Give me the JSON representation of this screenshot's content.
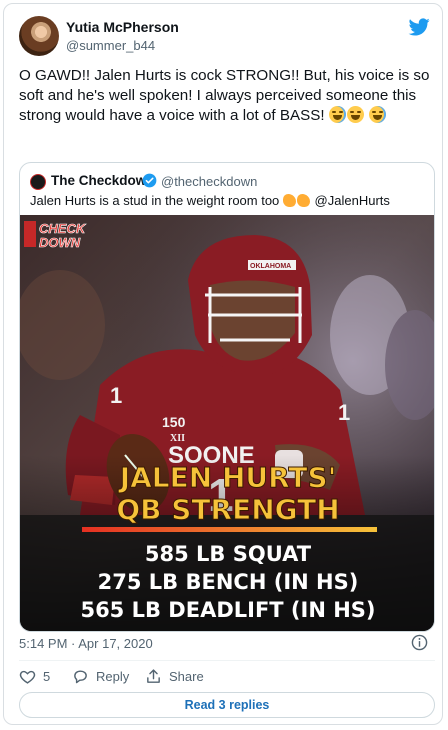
{
  "author": {
    "display_name": "Yutia McPherson",
    "handle": "@summer_b44"
  },
  "tweet": {
    "text": "O GAWD!! Jalen Hurts is cock STRONG!! But, his voice is so soft and he's well spoken! I always perceived someone this strong would have a voice with a lot of BASS!",
    "emojis": [
      "face-with-tears-of-joy",
      "grinning-squinting-face",
      "grinning-sweat-face"
    ]
  },
  "quoted": {
    "display_name": "The Checkdown",
    "handle": "@thecheckdown",
    "text": "Jalen Hurts is a stud in the weight room too",
    "mention": "@JalenHurts",
    "image": {
      "logo_top": "CHECK",
      "logo_bottom": "DOWN",
      "jersey_text": "SOONE",
      "jersey_number": "1",
      "helmet_text": "OKLAHOMA",
      "patch_number": "150",
      "patch_letters": "XII",
      "headline_line1": "JALEN HURTS'",
      "headline_line2": "QB STRENGTH",
      "stats": [
        "585 LB SQUAT",
        "275 LB BENCH (IN HS)",
        "565 LB DEADLIFT (IN HS)"
      ]
    }
  },
  "footer": {
    "timestamp": "5:14 PM · Apr 17, 2020",
    "like_count": "5",
    "reply_label": "Reply",
    "share_label": "Share",
    "read_replies_label": "Read 3 replies"
  },
  "colors": {
    "twitter_blue": "#1d9bf0",
    "crimson": "#8a1c24",
    "headline_gold": "#f6c23a",
    "underline_red": "#e53022"
  },
  "icons": [
    "twitter-bird-icon",
    "verified-badge-icon",
    "info-icon",
    "heart-icon",
    "reply-icon",
    "share-icon"
  ]
}
